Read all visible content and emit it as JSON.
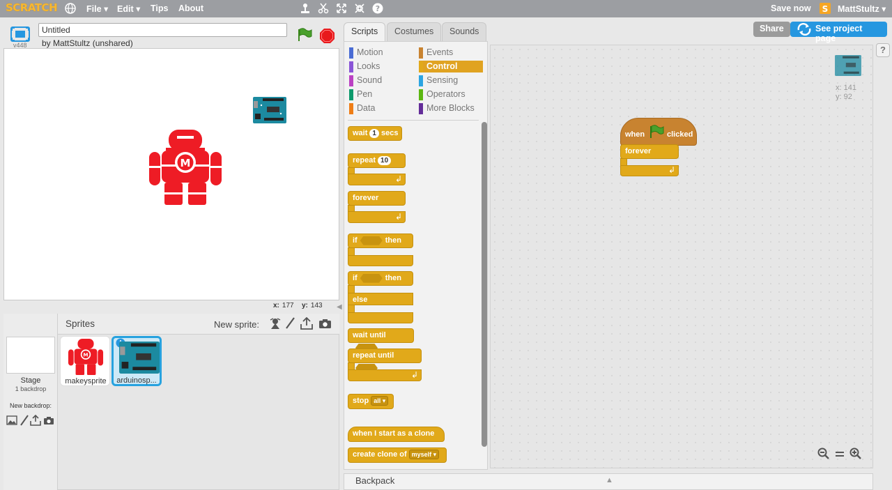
{
  "menu": {
    "logo": "SCRATCH",
    "items": [
      "File ▾",
      "Edit ▾",
      "Tips",
      "About"
    ],
    "save_now": "Save now",
    "username": "MattStultz ▾"
  },
  "project": {
    "version": "v448",
    "title": "Untitled",
    "byline": "by MattStultz (unshared)"
  },
  "stage": {
    "x_label": "x:",
    "x_value": "177",
    "y_label": "y:",
    "y_value": "143"
  },
  "sprites_pane": {
    "header": "Sprites",
    "new_sprite": "New sprite:",
    "stage_label": "Stage",
    "backdrop_count": "1 backdrop",
    "new_backdrop": "New backdrop:",
    "sprites": [
      {
        "name": "makeysprite"
      },
      {
        "name": "arduinosp..."
      }
    ]
  },
  "tabs": [
    "Scripts",
    "Costumes",
    "Sounds"
  ],
  "buttons": {
    "share": "Share",
    "see_project": "See project page"
  },
  "categories": {
    "left": [
      {
        "label": "Motion",
        "color": "#4a6cd4"
      },
      {
        "label": "Looks",
        "color": "#8a55d7"
      },
      {
        "label": "Sound",
        "color": "#bb42c3"
      },
      {
        "label": "Pen",
        "color": "#0e9a6c"
      },
      {
        "label": "Data",
        "color": "#ee7d16"
      }
    ],
    "right": [
      {
        "label": "Events",
        "color": "#c88330"
      },
      {
        "label": "Control",
        "color": "#e1a91a"
      },
      {
        "label": "Sensing",
        "color": "#2ca5e2"
      },
      {
        "label": "Operators",
        "color": "#5cb712"
      },
      {
        "label": "More Blocks",
        "color": "#632d99"
      }
    ]
  },
  "blocks": {
    "wait": "wait",
    "wait_value": "1",
    "secs": "secs",
    "repeat": "repeat",
    "repeat_value": "10",
    "forever": "forever",
    "if": "if",
    "then": "then",
    "else": "else",
    "wait_until": "wait until",
    "repeat_until": "repeat until",
    "stop": "stop",
    "stop_option": "all ▾",
    "when_clone": "when I start as a clone",
    "create_clone": "create clone of",
    "create_clone_option": "myself ▾"
  },
  "script": {
    "when": "when",
    "clicked": "clicked",
    "forever": "forever"
  },
  "sprite_info": {
    "x": "x: 141",
    "y": "y: 92"
  },
  "backpack": "Backpack",
  "help": "?"
}
